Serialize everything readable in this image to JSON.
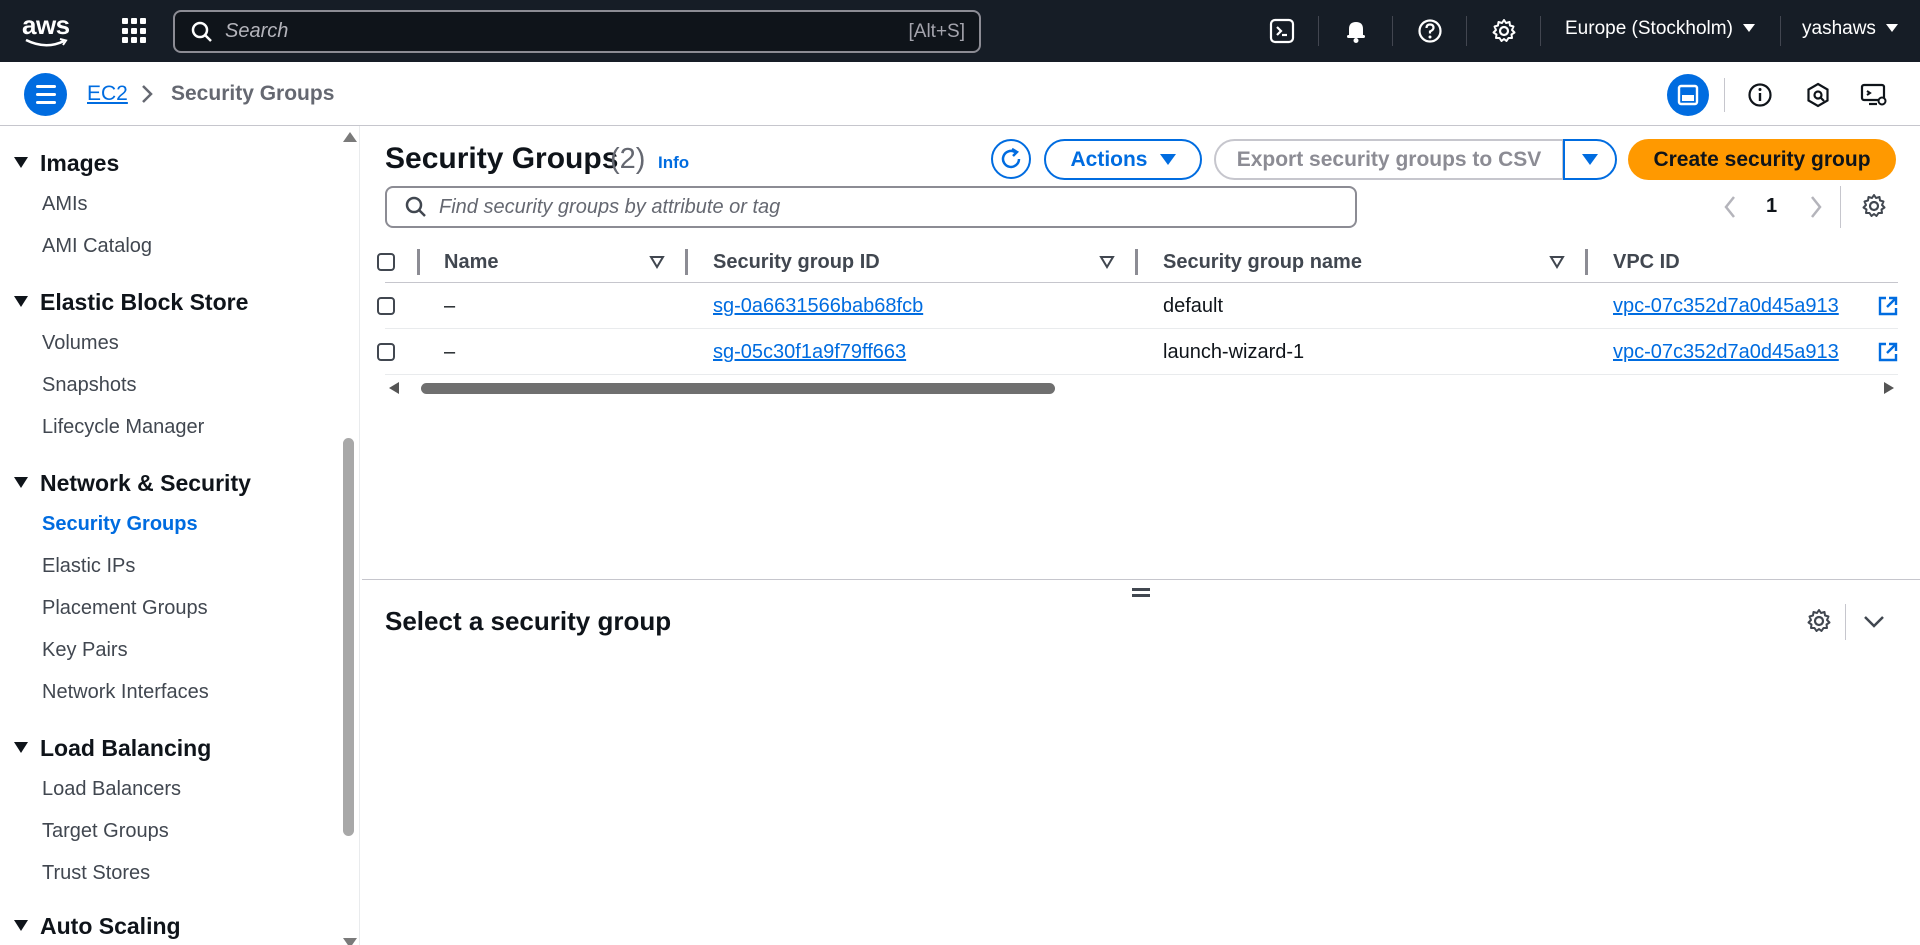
{
  "topnav": {
    "logo_text": "aws",
    "search_placeholder": "Search",
    "search_shortcut": "[Alt+S]",
    "region": "Europe (Stockholm)",
    "user": "yashaws"
  },
  "breadcrumb": {
    "service": "EC2",
    "current": "Security Groups"
  },
  "sidebar": {
    "sections": [
      {
        "title": "Images",
        "items": [
          "AMIs",
          "AMI Catalog"
        ]
      },
      {
        "title": "Elastic Block Store",
        "items": [
          "Volumes",
          "Snapshots",
          "Lifecycle Manager"
        ]
      },
      {
        "title": "Network & Security",
        "items": [
          "Security Groups",
          "Elastic IPs",
          "Placement Groups",
          "Key Pairs",
          "Network Interfaces"
        ]
      },
      {
        "title": "Load Balancing",
        "items": [
          "Load Balancers",
          "Target Groups",
          "Trust Stores"
        ]
      },
      {
        "title": "Auto Scaling",
        "items": []
      }
    ],
    "active_item": "Security Groups"
  },
  "main": {
    "title": "Security Groups",
    "count": "(2)",
    "info": "Info",
    "actions_label": "Actions",
    "export_label": "Export security groups to CSV",
    "create_label": "Create security group",
    "filter_placeholder": "Find security groups by attribute or tag",
    "page_number": "1",
    "columns": [
      "Name",
      "Security group ID",
      "Security group name",
      "VPC ID"
    ],
    "rows": [
      {
        "name": "–",
        "id": "sg-0a6631566bab68fcb",
        "group_name": "default",
        "vpc": "vpc-07c352d7a0d45a913"
      },
      {
        "name": "–",
        "id": "sg-05c30f1a9f79ff663",
        "group_name": "launch-wizard-1",
        "vpc": "vpc-07c352d7a0d45a913"
      }
    ]
  },
  "split_panel": {
    "title": "Select a security group"
  },
  "colors": {
    "nav_bg": "#161d26",
    "link": "#006ce0",
    "primary_button": "#ff9900",
    "text": "#0f141a"
  }
}
